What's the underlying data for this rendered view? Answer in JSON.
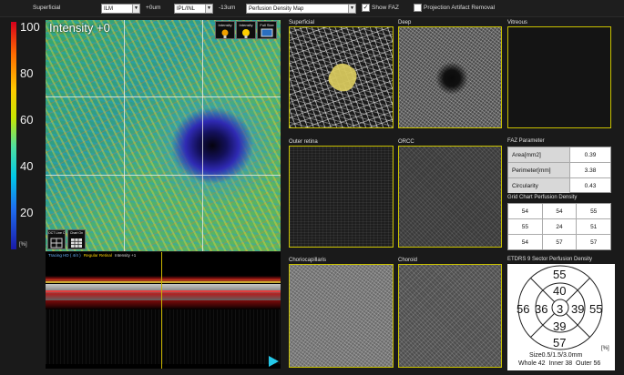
{
  "toolbar": {
    "layer": "Superficial",
    "top_boundary": "ILM",
    "top_offset": "+0um",
    "bottom_boundary": "IPL/INL",
    "bottom_offset": "-13um",
    "map_type": "Perfusion Density Map",
    "show_faz": "Show FAZ",
    "projection_artifact_removal": "Projection Artifact Removal"
  },
  "colorbar": {
    "ticks": [
      "100",
      "80",
      "60",
      "40",
      "20"
    ],
    "unit": "[%]"
  },
  "enface": {
    "intensity_label": "Intensity +0",
    "tools": [
      "Intensity",
      "Intensity",
      "Full Size"
    ],
    "oct_line_off": "OCT Line Off",
    "chart_on": "Chart On"
  },
  "bscan": {
    "tracing": "Tracing HD ( 4/4 )",
    "regular_retinal": "Regular Retinal",
    "intensity": "Intensity +1"
  },
  "panels": {
    "superficial": "Superficial",
    "deep": "Deep",
    "vitreous": "Vitreous",
    "outer_retina": "Outer retina",
    "orcc": "ORCC",
    "choriocapillaris": "Choriocapillaris",
    "choroid": "Choroid"
  },
  "faz": {
    "title": "FAZ Parameter",
    "rows": [
      {
        "label": "Area[mm2]",
        "value": "0.39"
      },
      {
        "label": "Perimeter[mm]",
        "value": "3.38"
      },
      {
        "label": "Circularity",
        "value": "0.43"
      }
    ]
  },
  "grid_chart": {
    "title": "Grid Chart Perfusion Density",
    "rows": [
      [
        "54",
        "54",
        "55"
      ],
      [
        "55",
        "24",
        "51"
      ],
      [
        "54",
        "57",
        "57"
      ]
    ]
  },
  "etdrs": {
    "title": "ETDRS 9 Sector Perfusion Density",
    "outer_top": "55",
    "inner_top": "40",
    "outer_left": "56",
    "inner_left": "36",
    "center": "3",
    "inner_right": "39",
    "outer_right": "55",
    "inner_bottom": "39",
    "outer_bottom": "57",
    "unit": "[%]",
    "size": "Size0.5/1.5/3.0mm",
    "summary": "Whole 42  Inner 38  Outer 56"
  },
  "colors": {
    "frame": "#c9c100",
    "faz_overlay": "#e0d060",
    "play": "#24c8e8"
  }
}
